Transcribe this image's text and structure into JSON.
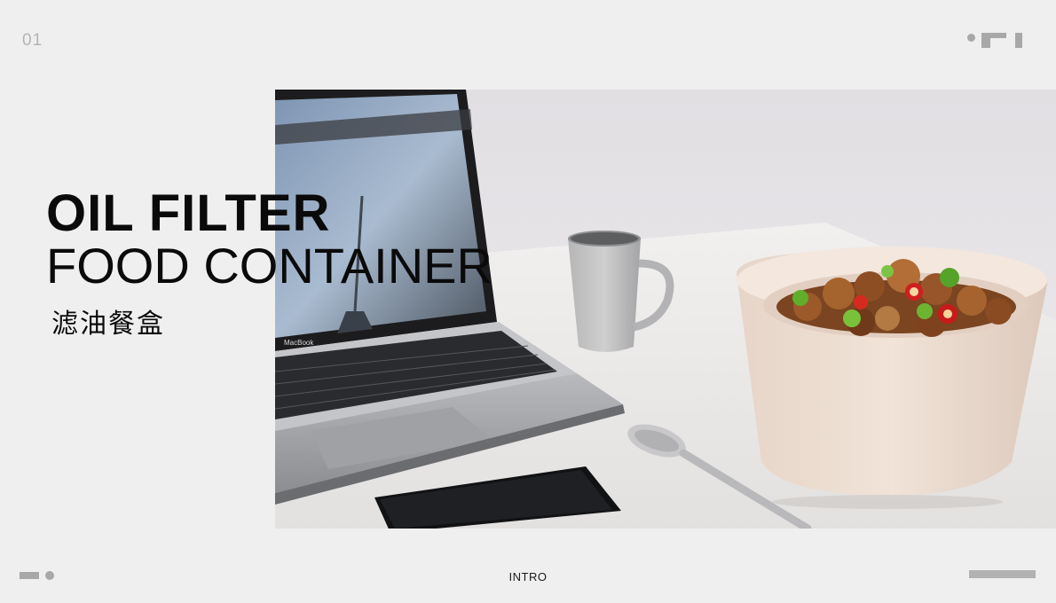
{
  "page": {
    "number": "01",
    "footer_label": "INTRO"
  },
  "title": {
    "line1": "OIL FILTER",
    "line2": "FOOD CONTAINER",
    "chinese": "滤油餐盒"
  },
  "photo": {
    "laptop_brand": "MacBook"
  },
  "colors": {
    "background": "#efefef",
    "accent_gray": "#a8a8a8",
    "bowl": "#ecdcd0",
    "text": "#0a0a0a"
  }
}
